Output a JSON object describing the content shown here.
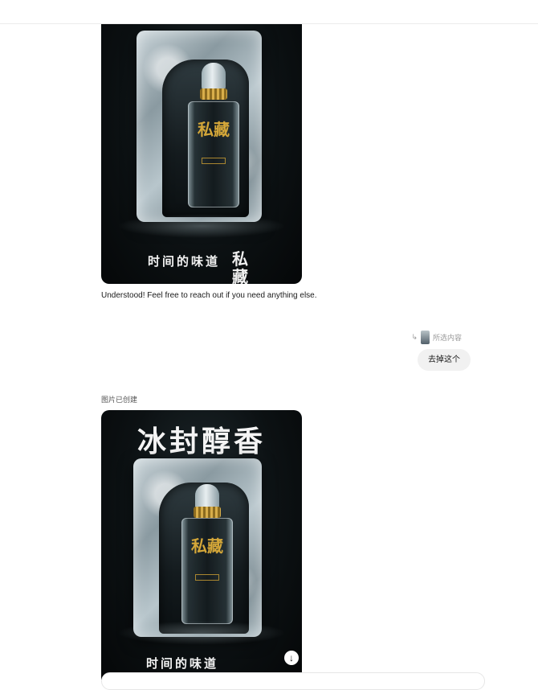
{
  "conversation": {
    "assistant_reply": "Understood! Feel free to reach out if you need anything else.",
    "quote": {
      "arrow": "↳",
      "label": "所选内容"
    },
    "user_message": "去掉这个",
    "status": "图片已创建"
  },
  "image_1": {
    "bottle_label": "私藏",
    "caption": "时间的味道",
    "caption_vertical": "私藏"
  },
  "image_2": {
    "headline": "冰封醇香",
    "bottle_label": "私藏",
    "caption": "时间的味道",
    "download_icon": "↓"
  },
  "colors": {
    "accent_gold": "#d4a739",
    "bubble": "#f1f1f1"
  }
}
